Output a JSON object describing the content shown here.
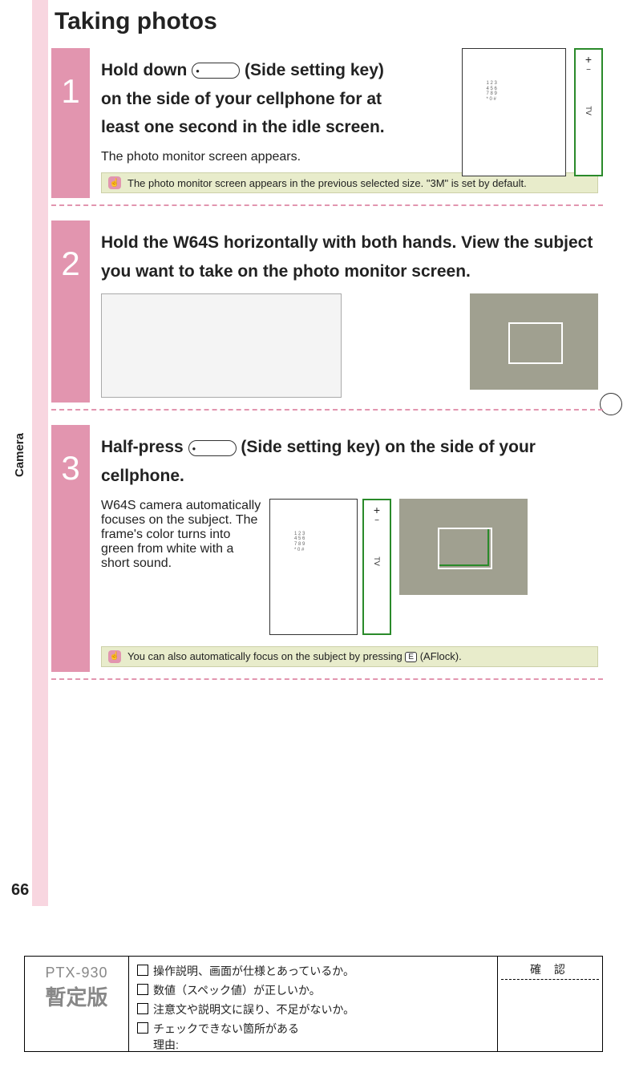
{
  "side_tab": "Camera",
  "title": "Taking photos",
  "steps": [
    {
      "num": "1",
      "heading_before_icon": "Hold down ",
      "heading_after_icon": " (Side setting key) on the side of your cellphone for at least one second in the idle screen.",
      "sub": "The photo monitor screen appears.",
      "note": "The photo monitor screen appears in the previous selected size. \"3M\" is set by default."
    },
    {
      "num": "2",
      "heading": "Hold the W64S horizontally with both hands. View the subject you want to take on the photo monitor screen."
    },
    {
      "num": "3",
      "heading_before_icon": "Half-press ",
      "heading_after_icon": " (Side setting key) on the side of your cellphone.",
      "sub": "W64S camera automatically focuses on the subject. The frame's color turns into green from white with a short sound.",
      "note_before": "You can also automatically focus on the subject by pressing ",
      "note_key": "E",
      "note_after": " (AFlock)."
    }
  ],
  "callout": {
    "plus": "+",
    "minus": "−",
    "tv": "TV"
  },
  "page_number": "66",
  "footer": {
    "ptx": "PTX-930",
    "tentative": "暫定版",
    "checks": [
      "操作説明、画面が仕様とあっているか。",
      "数値（スペック値）が正しいか。",
      "注意文や説明文に誤り、不足がないか。",
      "チェックできない箇所がある"
    ],
    "reason_label": "理由:",
    "confirm": "確 認"
  }
}
